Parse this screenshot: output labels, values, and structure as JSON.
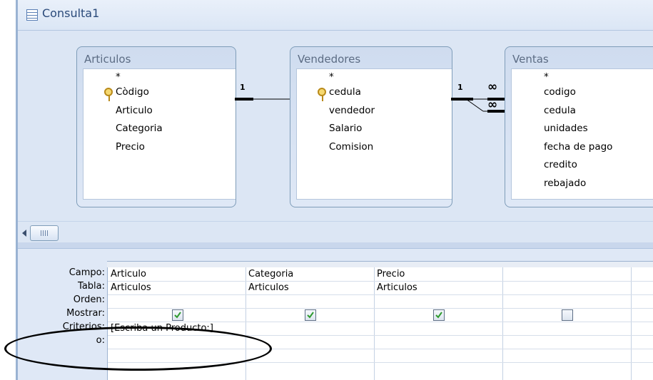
{
  "window": {
    "title": "Consulta1"
  },
  "tables": [
    {
      "name": "Articulos",
      "fields": [
        "*",
        "Còdigo",
        "Articulo",
        "Categoria",
        "Precio"
      ],
      "key_field": "Còdigo"
    },
    {
      "name": "Vendedores",
      "fields": [
        "*",
        "cedula",
        "vendedor",
        "Salario",
        "Comision"
      ],
      "key_field": "cedula"
    },
    {
      "name": "Ventas",
      "fields": [
        "*",
        "codigo",
        "cedula",
        "unidades",
        "fecha de pago",
        "credito",
        "rebajado"
      ]
    }
  ],
  "relations": [
    {
      "from": "Articulos.Còdigo",
      "to": "Ventas.codigo",
      "from_label": "1",
      "to_label": "∞"
    },
    {
      "from": "Vendedores.cedula",
      "to": "Ventas.cedula",
      "from_label": "1",
      "to_label": "∞"
    }
  ],
  "grid": {
    "row_labels": [
      "Campo:",
      "Tabla:",
      "Orden:",
      "Mostrar:",
      "Criterios:",
      "o:"
    ],
    "columns": [
      {
        "campo": "Articulo",
        "tabla": "Articulos",
        "orden": "",
        "mostrar": true,
        "criterios": "[Escriba un Producto:]",
        "o": ""
      },
      {
        "campo": "Categoria",
        "tabla": "Articulos",
        "orden": "",
        "mostrar": true,
        "criterios": "",
        "o": ""
      },
      {
        "campo": "Precio",
        "tabla": "Articulos",
        "orden": "",
        "mostrar": true,
        "criterios": "",
        "o": ""
      },
      {
        "campo": "",
        "tabla": "",
        "orden": "",
        "mostrar": false,
        "criterios": "",
        "o": ""
      }
    ]
  },
  "colors": {
    "background": "#dfe8f6",
    "check": "#2e9a2e",
    "annotation": "#000000"
  }
}
